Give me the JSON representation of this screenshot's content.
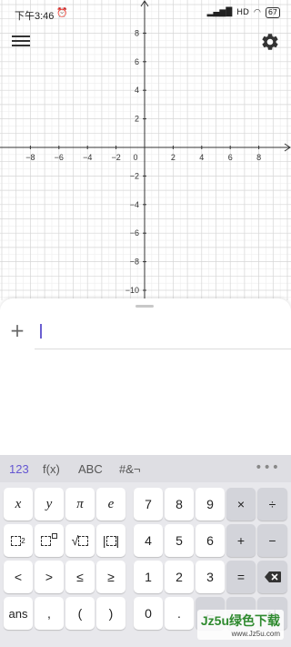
{
  "status_bar": {
    "time": "下午3:46",
    "alarm_icon": "alarm-icon",
    "signal": "HD",
    "battery": "67"
  },
  "graph": {
    "x_ticks": [
      "−8",
      "−6",
      "−4",
      "−2",
      "0",
      "2",
      "4",
      "6",
      "8"
    ],
    "y_ticks_pos": [
      "8",
      "6",
      "4",
      "2"
    ],
    "y_ticks_neg": [
      "−2",
      "−4",
      "−6",
      "−8",
      "−10"
    ],
    "grid": true,
    "x_range": [
      -10,
      10
    ],
    "y_range": [
      -10.3,
      10.2
    ]
  },
  "algebra": {
    "add_icon": "+",
    "input_value": "",
    "input_placeholder": ""
  },
  "keyboard": {
    "tabs": [
      "123",
      "f(x)",
      "ABC",
      "#&¬"
    ],
    "active_tab": "123",
    "more": "•••",
    "row1_left": [
      "x",
      "y",
      "π",
      "e"
    ],
    "row1_right": [
      "7",
      "8",
      "9",
      "×",
      "÷"
    ],
    "row2_right": [
      "4",
      "5",
      "6",
      "+",
      "−"
    ],
    "row3_left": [
      "<",
      ">",
      "≤",
      "≥"
    ],
    "row3_right": [
      "1",
      "2",
      "3",
      "="
    ],
    "row4_left": [
      "ans",
      ",",
      "(",
      ")"
    ],
    "row4_right": [
      "0",
      "."
    ]
  },
  "watermark": {
    "text": "Jz5u绿色下载",
    "sub": "www.Jz5u.com"
  },
  "colors": {
    "accent": "#6557d2",
    "axis": "#333333",
    "grid_major": "#d6d6d6",
    "grid_minor": "#eeeeee"
  }
}
